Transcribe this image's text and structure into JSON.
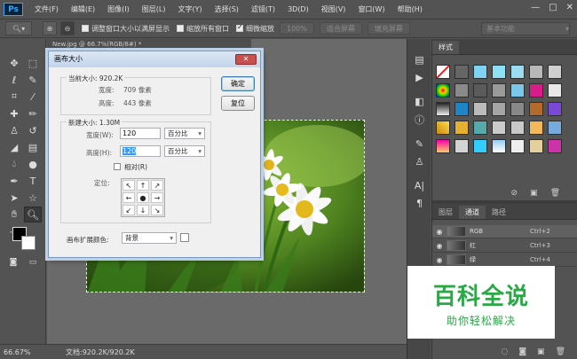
{
  "app": {
    "logo": "Ps"
  },
  "menu": [
    "文件(F)",
    "编辑(E)",
    "图像(I)",
    "图层(L)",
    "文字(Y)",
    "选择(S)",
    "滤镜(T)",
    "3D(D)",
    "视图(V)",
    "窗口(W)",
    "帮助(H)"
  ],
  "window_controls": {
    "minimize": "—",
    "restore": "□",
    "close": "✕"
  },
  "options": {
    "tool_icon": "zoom-icon",
    "zoom_in": "⊕",
    "zoom_out": "⊖",
    "resize_windows": "调整窗口大小以满屏显示",
    "zoom_all_windows": "缩放所有窗口",
    "scrubby_zoom": "细微缩放",
    "btn_100": "100%",
    "btn_fit": "适合屏幕",
    "btn_fill": "填充屏幕",
    "workspace": "基本功能"
  },
  "document": {
    "tab_label": "New.jpg @ 66.7%(RGB/8#) *",
    "zoom": "66.67%",
    "info": "文档:920.2K/920.2K"
  },
  "dialog": {
    "title": "画布大小",
    "current_group": "当前大小: 920.2K",
    "width_label": "宽度:",
    "width_value": "709 像素",
    "height_label": "高度:",
    "height_value": "443 像素",
    "new_group": "新建大小: 1.30M",
    "new_width_label": "宽度(W):",
    "new_width": "120",
    "new_width_unit": "百分比",
    "new_height_label": "高度(H):",
    "new_height": "120",
    "new_height_unit": "百分比",
    "relative": "相对(R)",
    "anchor_label": "定位:",
    "ext_color_label": "画布扩展颜色:",
    "ext_color": "背景",
    "ok": "确定",
    "reset": "复位"
  },
  "styles_panel": {
    "tab": "样式"
  },
  "channels_panel": {
    "tabs": [
      "图层",
      "通道",
      "路径"
    ],
    "channels": [
      {
        "name": "RGB",
        "shortcut": "Ctrl+2"
      },
      {
        "name": "红",
        "shortcut": "Ctrl+3"
      },
      {
        "name": "绿",
        "shortcut": "Ctrl+4"
      }
    ]
  },
  "watermark": {
    "title": "百科全说",
    "subtitle": "助你轻松解决"
  },
  "colors": {
    "accent": "#31a8ff",
    "watermark": "#29a845",
    "dialog_title": "#c3d5ec"
  }
}
